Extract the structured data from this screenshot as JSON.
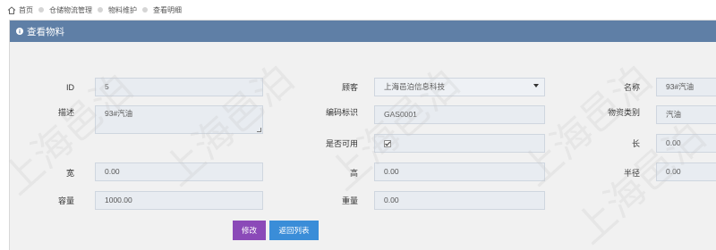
{
  "breadcrumb": {
    "items": [
      "首页",
      "仓储物流管理",
      "物料维护",
      "查看明细"
    ]
  },
  "panel": {
    "title": "查看物料"
  },
  "form": {
    "id": {
      "label": "ID",
      "value": "5"
    },
    "tenant": {
      "label": "顾客",
      "value": "上海邑泊信息科技"
    },
    "name": {
      "label": "名称",
      "value": "93#汽油"
    },
    "description": {
      "label": "描述",
      "value": "93#汽油"
    },
    "code": {
      "label": "编码标识",
      "value": "GAS0001"
    },
    "category": {
      "label": "物资类别",
      "value": "汽油"
    },
    "enabled": {
      "label": "是否可用",
      "checked": true
    },
    "length": {
      "label": "长",
      "value": "0.00"
    },
    "width": {
      "label": "宽",
      "value": "0.00"
    },
    "height": {
      "label": "高",
      "value": "0.00"
    },
    "radius": {
      "label": "半径",
      "value": "0.00"
    },
    "capacity": {
      "label": "容量",
      "value": "1000.00"
    },
    "weight": {
      "label": "重量",
      "value": "0.00"
    }
  },
  "actions": {
    "edit_label": "修改",
    "back_label": "返回列表"
  },
  "watermark": {
    "text": "上海邑泊"
  },
  "colors": {
    "header": "#5f7fa6",
    "edit_button": "#8b4ab8",
    "back_button": "#3a8dd8",
    "field_bg": "#e8ecf1"
  }
}
